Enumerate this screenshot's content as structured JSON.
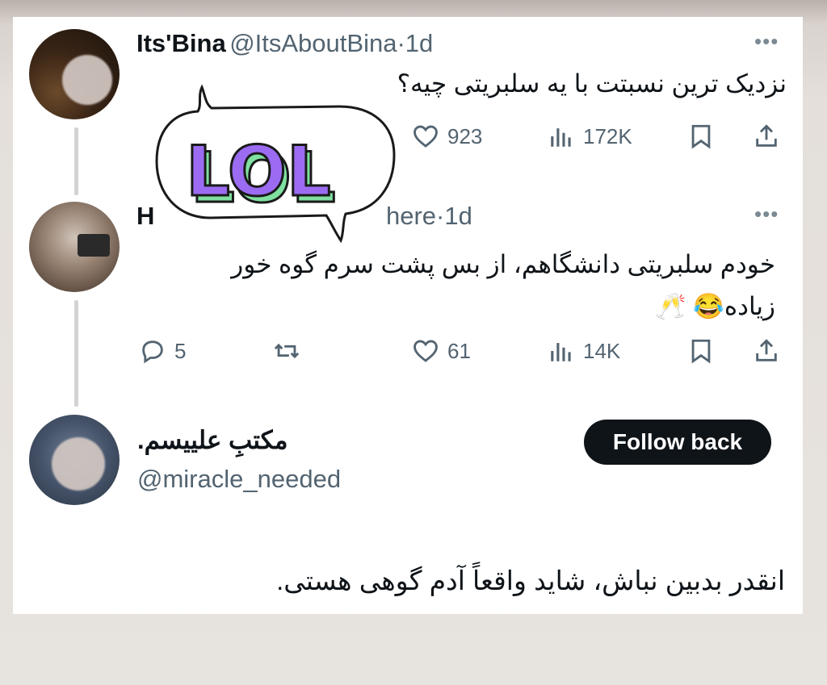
{
  "tweet1": {
    "name": "Its'Bina",
    "handle": "@ItsAboutBina",
    "sep": "·",
    "time": "1d",
    "text": "نزدیک ترین نسبتت با یه سلبریتی چیه؟",
    "likes": "923",
    "views": "172K"
  },
  "tweet2": {
    "name": "H",
    "handle_visible": "here",
    "sep": "·",
    "time": "1d",
    "text_line1": "خودم سلبریتی دانشگاهم، از بس پشت سرم گوه خور",
    "text_line2": "زیاده😂 🥂",
    "replies": "5",
    "likes": "61",
    "views": "14K"
  },
  "profile": {
    "name": "مکتبِ علییسم.",
    "handle": "@miracle_needed",
    "follow_label": "Follow back",
    "bio": "انقدر بدبین نباش، شاید واقعاً آدم گوهی هستی."
  },
  "sticker": {
    "text": "LOL",
    "colors": {
      "fill": "#9b6cf2",
      "side": "#7fe0a0",
      "outline": "#1a1a1a"
    }
  },
  "icons": [
    "reply-icon",
    "retweet-icon",
    "like-icon",
    "views-icon",
    "bookmark-icon",
    "share-icon",
    "more-icon"
  ]
}
